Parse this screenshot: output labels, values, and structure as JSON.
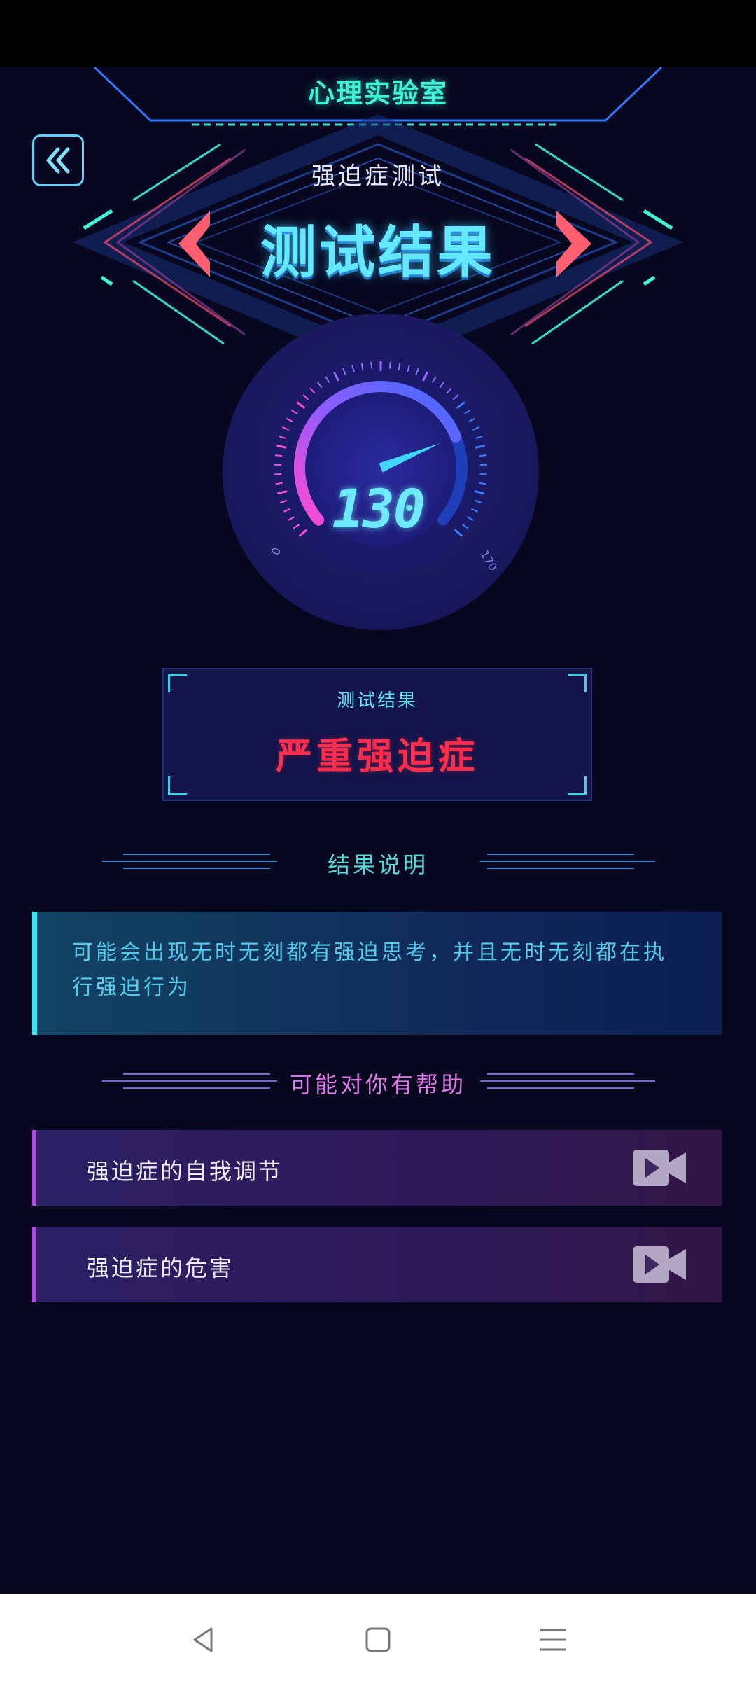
{
  "header": {
    "lab_title": "心理实验室",
    "test_name": "强迫症测试",
    "result_heading": "测试结果"
  },
  "gauge": {
    "value": "130",
    "min_label": "0",
    "max_label": "170",
    "fill_fraction": 0.76
  },
  "result": {
    "label": "测试结果",
    "value": "严重强迫症"
  },
  "explanation": {
    "section_title": "结果说明",
    "text": "可能会出现无时无刻都有强迫思考，并且无时无刻都在执行强迫行为"
  },
  "help": {
    "section_title": "可能对你有帮助",
    "items": [
      {
        "label": "强迫症的自我调节",
        "icon": "video-camera-icon"
      },
      {
        "label": "强迫症的危害",
        "icon": "video-camera-icon"
      }
    ]
  },
  "colors": {
    "background": "#07081f",
    "accent_cyan": "#3ff3d7",
    "result_red": "#ff2d4b",
    "help_accent": "#b04ce6"
  }
}
